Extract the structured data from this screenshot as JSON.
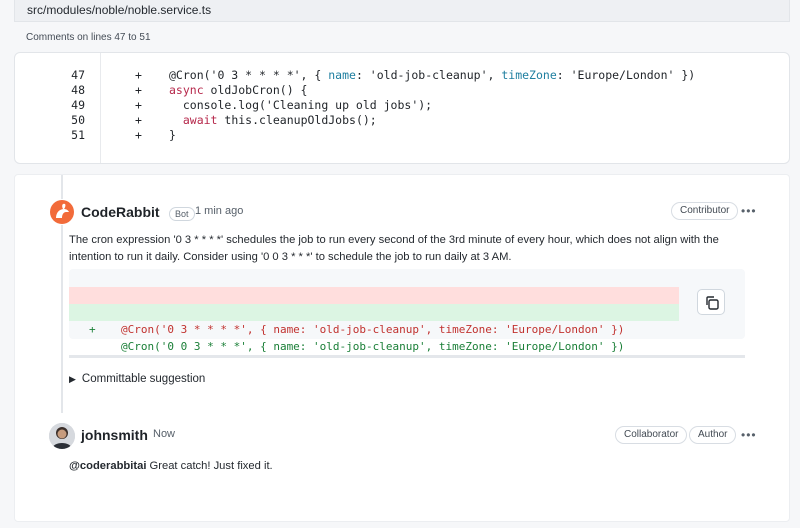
{
  "file": {
    "path": "src/modules/noble/noble.service.ts"
  },
  "comments_on": "Comments on lines 47 to 51",
  "code_lines": [
    {
      "num": "47",
      "sign": "+",
      "parts": [
        {
          "t": "@Cron('0 3 * * * *', { ",
          "c": ""
        },
        {
          "t": "name",
          "c": "prop"
        },
        {
          "t": ": 'old-job-cleanup', ",
          "c": ""
        },
        {
          "t": "timeZone",
          "c": "prop"
        },
        {
          "t": ": 'Europe/London' })",
          "c": ""
        }
      ]
    },
    {
      "num": "48",
      "sign": "+",
      "parts": [
        {
          "t": "async",
          "c": "kw"
        },
        {
          "t": " oldJobCron() {",
          "c": ""
        }
      ]
    },
    {
      "num": "49",
      "sign": "+",
      "parts": [
        {
          "t": "  console.log('Cleaning up old jobs');",
          "c": ""
        }
      ]
    },
    {
      "num": "50",
      "sign": "+",
      "parts": [
        {
          "t": "  ",
          "c": ""
        },
        {
          "t": "await",
          "c": "kw"
        },
        {
          "t": " this.cleanupOldJobs();",
          "c": ""
        }
      ]
    },
    {
      "num": "51",
      "sign": "+",
      "parts": [
        {
          "t": "}",
          "c": ""
        }
      ]
    }
  ],
  "bot_comment": {
    "author": "CodeRabbit",
    "badge": "Bot",
    "time": "1 min ago",
    "role": "Contributor",
    "more": "•••",
    "text_line1": "The cron expression '0 3 * * * *' schedules the job to run every second of the 3rd minute of every hour, which does not align with the",
    "text_line2": "intention to run it daily. Consider using '0 0 3 * * *' to schedule the job to run daily at 3 AM.",
    "suggestion": {
      "del_sign": "-",
      "del_text": "@Cron('0 3 * * * *', { name: 'old-job-cleanup', timeZone: 'Europe/London' })",
      "add_sign": "+",
      "add_text": "@Cron('0 0 3 * * *', { name: 'old-job-cleanup', timeZone: 'Europe/London' })"
    },
    "committable_label": "Committable suggestion"
  },
  "reply": {
    "author": "johnsmith",
    "time": "Now",
    "role1": "Collaborator",
    "role2": "Author",
    "more": "•••",
    "mention": "@coderabbitai",
    "text": " Great catch! Just fixed it."
  },
  "colors": {
    "accent_orange": "#f26b3a",
    "del_bg": "#ffdedd",
    "add_bg": "#dcf5e3"
  },
  "icons": {
    "bot_avatar": "rabbit-logo-icon",
    "copy": "copy-icon",
    "triangle": "triangle-right-icon"
  }
}
